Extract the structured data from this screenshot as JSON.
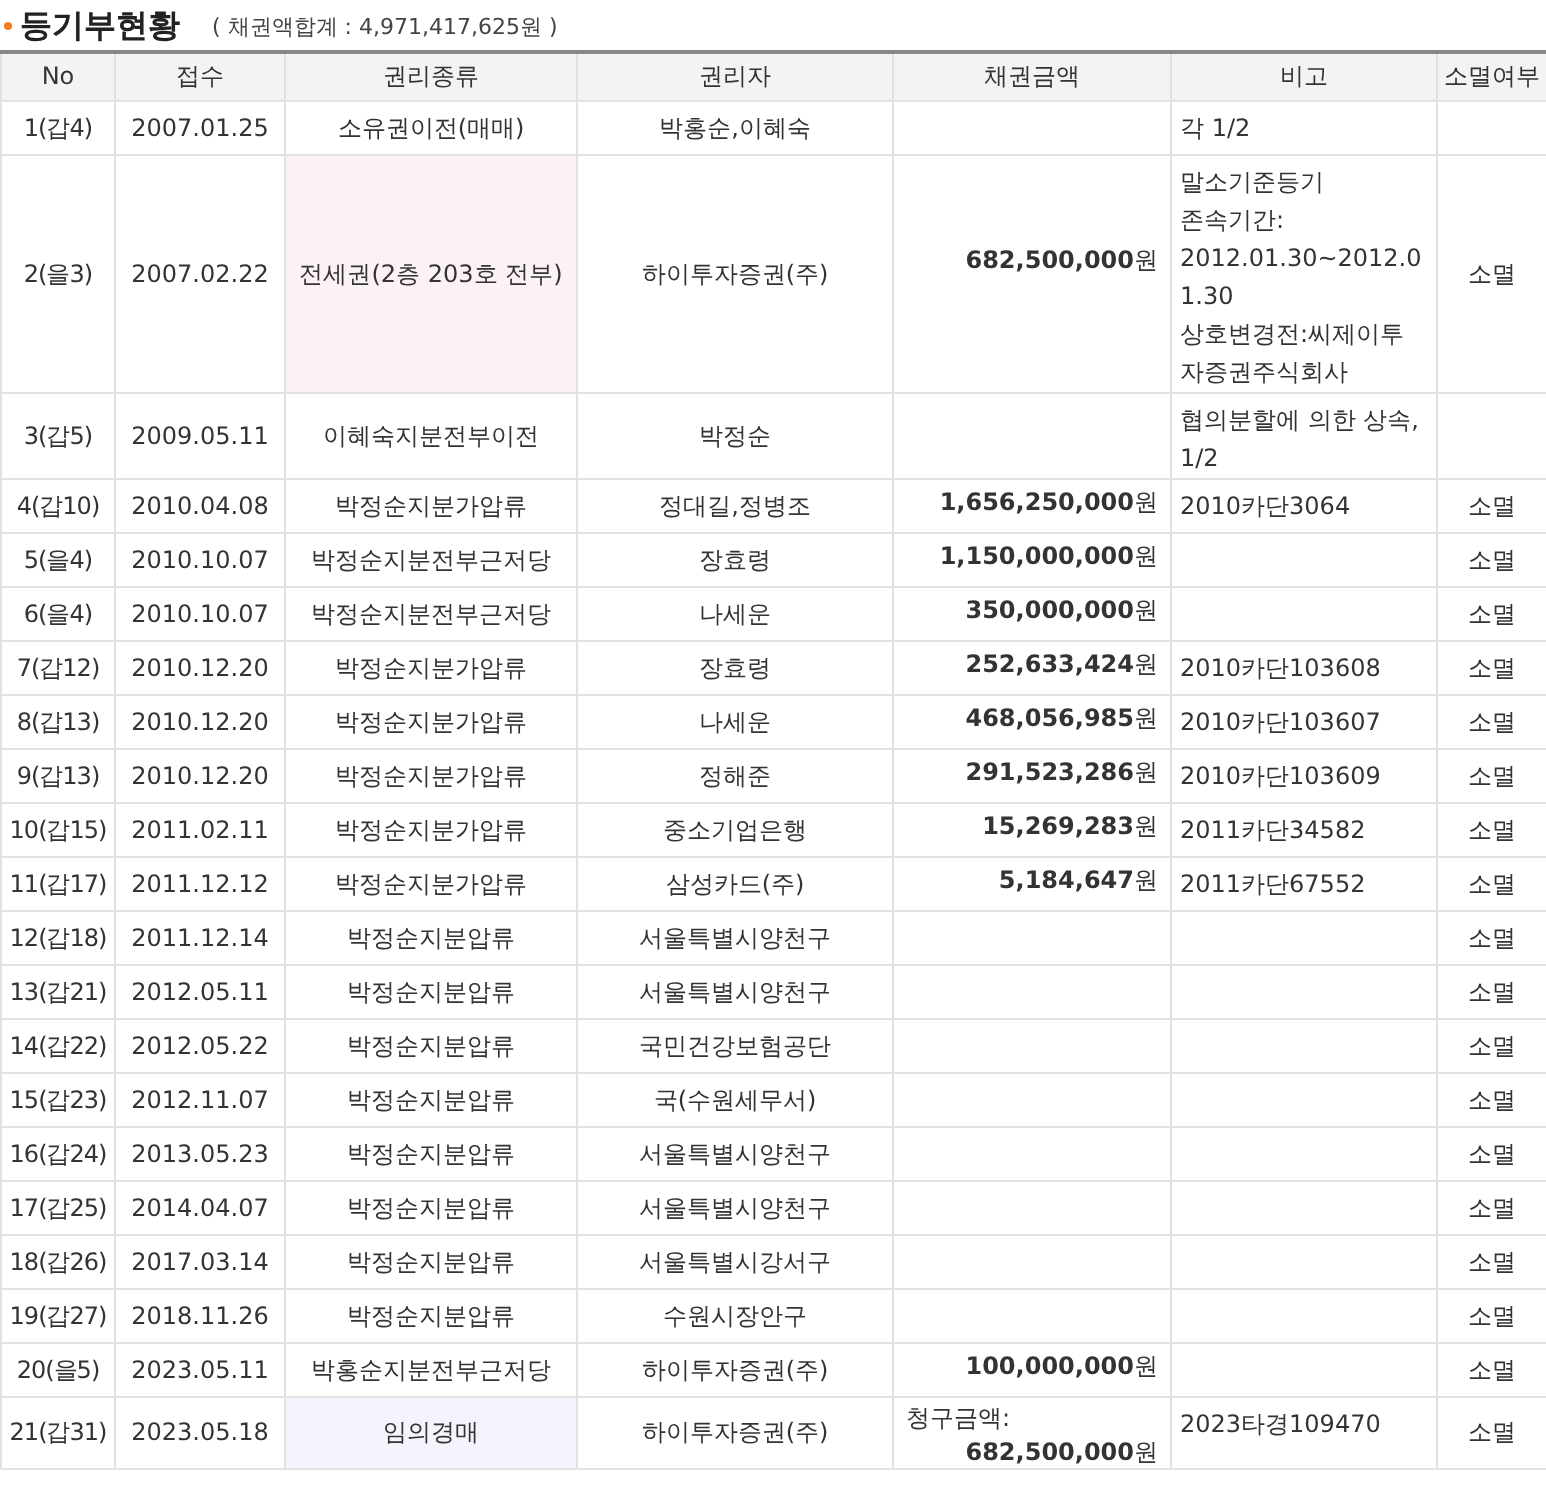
{
  "title": "등기부현황",
  "total": "( 채권액합계 : 4,971,417,625원 )",
  "columns": [
    "No",
    "접수",
    "권리종류",
    "권리자",
    "채권금액",
    "비고",
    "소멸여부"
  ],
  "rows": [
    {
      "no": "1(갑4)",
      "date": "2007.01.25",
      "type": "소유권이전(매매)",
      "holder": "박홍순,이혜숙",
      "amount": "",
      "remarks": "각 1/2",
      "status": ""
    },
    {
      "no": "2(을3)",
      "date": "2007.02.22",
      "type": "전세권(2층 203호 전부)",
      "color": "#fdf2f3",
      "holder": "하이투자증권(주)",
      "amount": "**682,500,000**원",
      "remarks": "말소기준등기\n존속기간:\n2012.01.30~2012.01.30\n상호변경전:씨제이투자증권주식회사",
      "status": "소멸"
    },
    {
      "no": "3(갑5)",
      "date": "2009.05.11",
      "type": "이혜숙지분전부이전",
      "holder": "박정순",
      "amount": "",
      "remarks": "협의분할에 의한 상속, 1/2",
      "status": ""
    },
    {
      "no": "4(갑10)",
      "date": "2010.04.08",
      "type": "박정순지분가압류",
      "holder": "정대길,정병조",
      "amount": "**1,656,250,000**원",
      "remarks": "2010카단3064",
      "status": "소멸"
    },
    {
      "no": "5(을4)",
      "date": "2010.10.07",
      "type": "박정순지분전부근저당",
      "holder": "장효령",
      "amount": "**1,150,000,000**원",
      "remarks": "",
      "status": "소멸"
    },
    {
      "no": "6(을4)",
      "date": "2010.10.07",
      "type": "박정순지분전부근저당",
      "holder": "나세운",
      "amount": "**350,000,000**원",
      "remarks": "",
      "status": "소멸"
    },
    {
      "no": "7(갑12)",
      "date": "2010.12.20",
      "type": "박정순지분가압류",
      "holder": "장효령",
      "amount": "**252,633,424**원",
      "remarks": "2010카단103608",
      "status": "소멸"
    },
    {
      "no": "8(갑13)",
      "date": "2010.12.20",
      "type": "박정순지분가압류",
      "holder": "나세운",
      "amount": "**468,056,985**원",
      "remarks": "2010카단103607",
      "status": "소멸"
    },
    {
      "no": "9(갑13)",
      "date": "2010.12.20",
      "type": "박정순지분가압류",
      "holder": "정해준",
      "amount": "**291,523,286**원",
      "remarks": "2010카단103609",
      "status": "소멸"
    },
    {
      "no": "10(갑15)",
      "date": "2011.02.11",
      "type": "박정순지분가압류",
      "holder": "중소기업은행",
      "amount": "**15,269,283**원",
      "remarks": "2011카단34582",
      "status": "소멸"
    },
    {
      "no": "11(갑17)",
      "date": "2011.12.12",
      "type": "박정순지분가압류",
      "holder": "삼성카드(주)",
      "amount": "**5,184,647**원",
      "remarks": "2011카단67552",
      "status": "소멸"
    },
    {
      "no": "12(갑18)",
      "date": "2011.12.14",
      "type": "박정순지분압류",
      "holder": "서울특별시양천구",
      "amount": "",
      "remarks": "",
      "status": "소멸"
    },
    {
      "no": "13(갑21)",
      "date": "2012.05.11",
      "type": "박정순지분압류",
      "holder": "서울특별시양천구",
      "amount": "",
      "remarks": "",
      "status": "소멸"
    },
    {
      "no": "14(갑22)",
      "date": "2012.05.22",
      "type": "박정순지분압류",
      "holder": "국민건강보험공단",
      "amount": "",
      "remarks": "",
      "status": "소멸"
    },
    {
      "no": "15(갑23)",
      "date": "2012.11.07",
      "type": "박정순지분압류",
      "holder": "국(수원세무서)",
      "amount": "",
      "remarks": "",
      "status": "소멸"
    },
    {
      "no": "16(갑24)",
      "date": "2013.05.23",
      "type": "박정순지분압류",
      "holder": "서울특별시양천구",
      "amount": "",
      "remarks": "",
      "status": "소멸"
    },
    {
      "no": "17(갑25)",
      "date": "2014.04.07",
      "type": "박정순지분압류",
      "holder": "서울특별시양천구",
      "amount": "",
      "remarks": "",
      "status": "소멸"
    },
    {
      "no": "18(갑26)",
      "date": "2017.03.14",
      "type": "박정순지분압류",
      "holder": "서울특별시강서구",
      "amount": "",
      "remarks": "",
      "status": "소멸"
    },
    {
      "no": "19(갑27)",
      "date": "2018.11.26",
      "type": "박정순지분압류",
      "holder": "수원시장안구",
      "amount": "",
      "remarks": "",
      "status": "소멸"
    },
    {
      "no": "20(을5)",
      "date": "2023.05.11",
      "type": "박홍순지분전부근저당",
      "holder": "하이투자증권(주)",
      "amount": "**100,000,000**원",
      "remarks": "",
      "status": "소멸"
    },
    {
      "no": "21(갑31)",
      "date": "2023.05.18",
      "type": "임의경매",
      "color": "#f4f4fd",
      "holder": "하이투자증권(주)",
      "amount_label": "청구금액:",
      "amount": "**682,500,000**원",
      "remarks": "2023타경109470",
      "status": "소멸"
    }
  ]
}
